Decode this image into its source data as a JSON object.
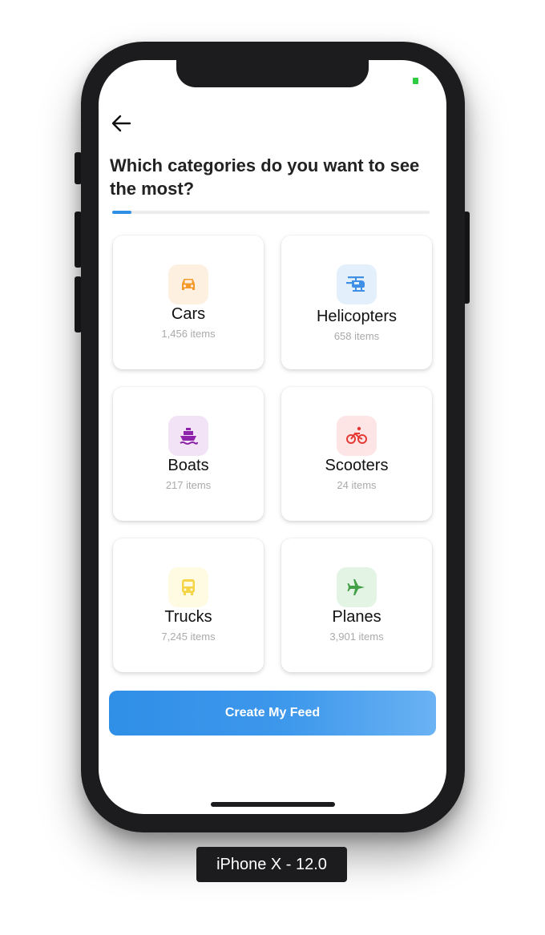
{
  "header": {
    "back_icon": "arrow-left-icon",
    "title": "Which categories do you want to see the most?"
  },
  "progress": {
    "fraction": 0.06,
    "color": "#2f8fe6"
  },
  "categories": [
    {
      "name": "Cars",
      "count": "1,456 items",
      "icon": "car-icon",
      "icon_color": "#f39a2a",
      "icon_bg": "#fdf0e1"
    },
    {
      "name": "Helicopters",
      "count": "658 items",
      "icon": "helicopter-icon",
      "icon_color": "#3f8fe6",
      "icon_bg": "#e3f0fc"
    },
    {
      "name": "Boats",
      "count": "217 items",
      "icon": "boat-icon",
      "icon_color": "#8e24aa",
      "icon_bg": "#f3e3f6"
    },
    {
      "name": "Scooters",
      "count": "24 items",
      "icon": "bicycle-icon",
      "icon_color": "#e53935",
      "icon_bg": "#fde5e5"
    },
    {
      "name": "Trucks",
      "count": "7,245 items",
      "icon": "bus-icon",
      "icon_color": "#f5d547",
      "icon_bg": "#fefbe2"
    },
    {
      "name": "Planes",
      "count": "3,901 items",
      "icon": "airplane-icon",
      "icon_color": "#43a047",
      "icon_bg": "#e3f4e4"
    }
  ],
  "cta": {
    "label": "Create My Feed"
  },
  "device_label": "iPhone X - 12.0"
}
